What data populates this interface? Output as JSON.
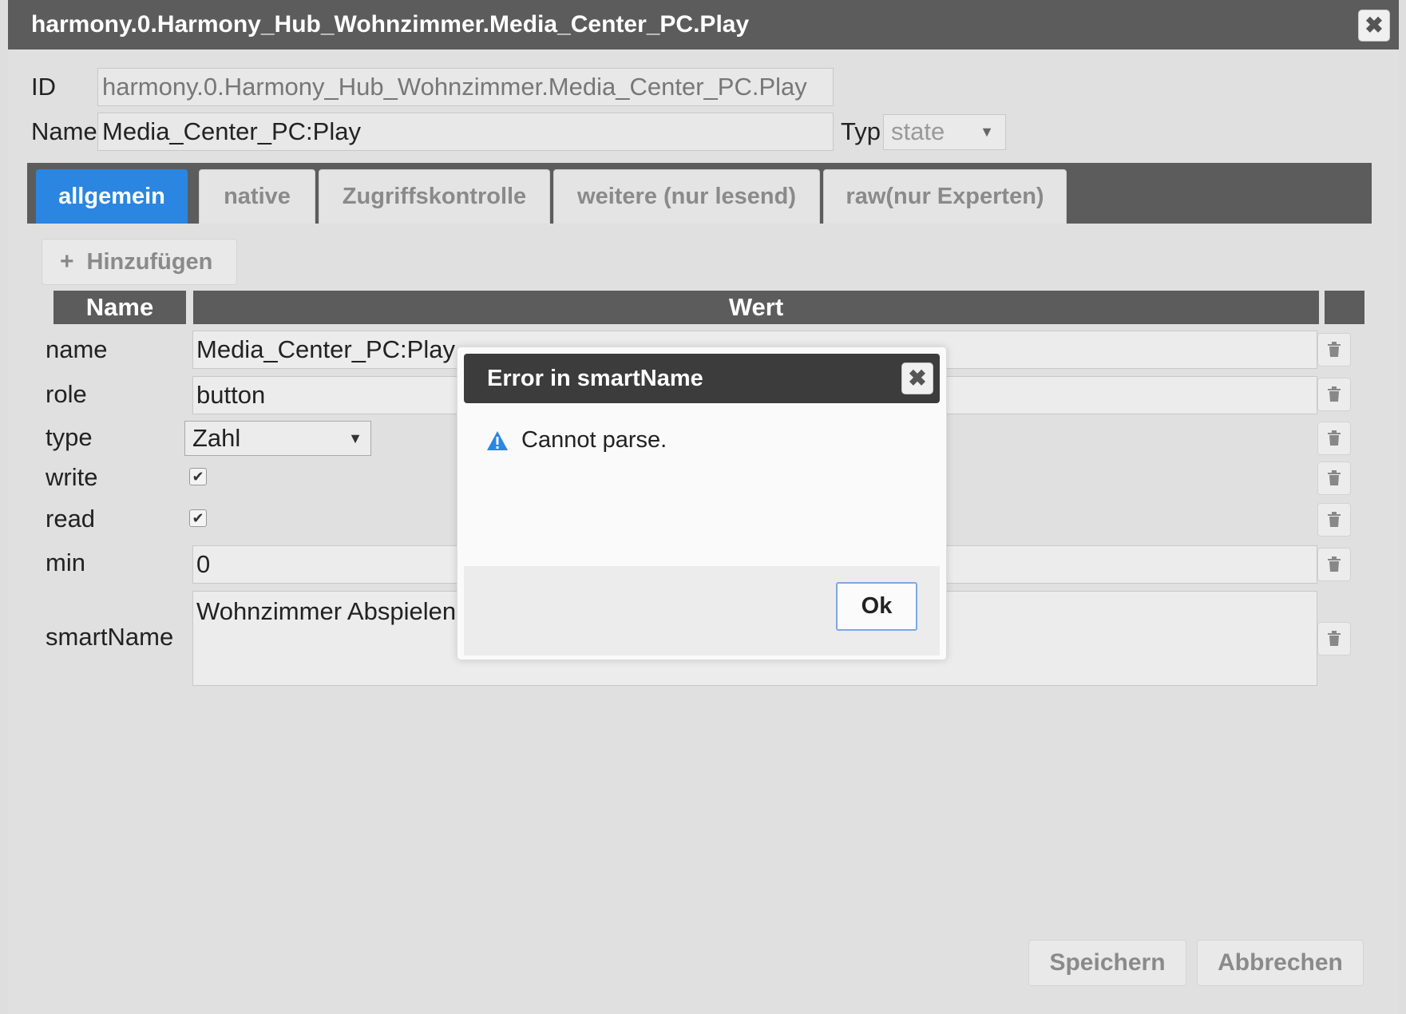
{
  "window": {
    "title": "harmony.0.Harmony_Hub_Wohnzimmer.Media_Center_PC.Play",
    "close_icon": "close-icon"
  },
  "header": {
    "id_label": "ID",
    "id_value": "harmony.0.Harmony_Hub_Wohnzimmer.Media_Center_PC.Play",
    "name_label": "Name",
    "name_value": "Media_Center_PC:Play",
    "typ_label": "Typ",
    "typ_value": "state"
  },
  "tabs": [
    {
      "label": "allgemein",
      "active": true
    },
    {
      "label": "native",
      "active": false
    },
    {
      "label": "Zugriffskontrolle",
      "active": false
    },
    {
      "label": "weitere (nur lesend)",
      "active": false
    },
    {
      "label": "raw(nur Experten)",
      "active": false
    }
  ],
  "toolbar": {
    "add_label": "Hinzufügen"
  },
  "table": {
    "col_name": "Name",
    "col_value": "Wert",
    "rows": {
      "name": {
        "label": "name",
        "value": "Media_Center_PC:Play"
      },
      "role": {
        "label": "role",
        "value": "button"
      },
      "type": {
        "label": "type",
        "value": "Zahl"
      },
      "write": {
        "label": "write",
        "checked": true
      },
      "read": {
        "label": "read",
        "checked": true
      },
      "min": {
        "label": "min",
        "value": "0"
      },
      "smartName": {
        "label": "smartName",
        "value": "Wohnzimmer Abspielen"
      }
    }
  },
  "footer": {
    "save_label": "Speichern",
    "cancel_label": "Abbrechen"
  },
  "modal": {
    "title": "Error in smartName",
    "message": "Cannot parse.",
    "ok_label": "Ok"
  },
  "colors": {
    "accent": "#2a86e0",
    "header_bg": "#5c5c5c",
    "modal_header_bg": "#3c3c3c"
  }
}
